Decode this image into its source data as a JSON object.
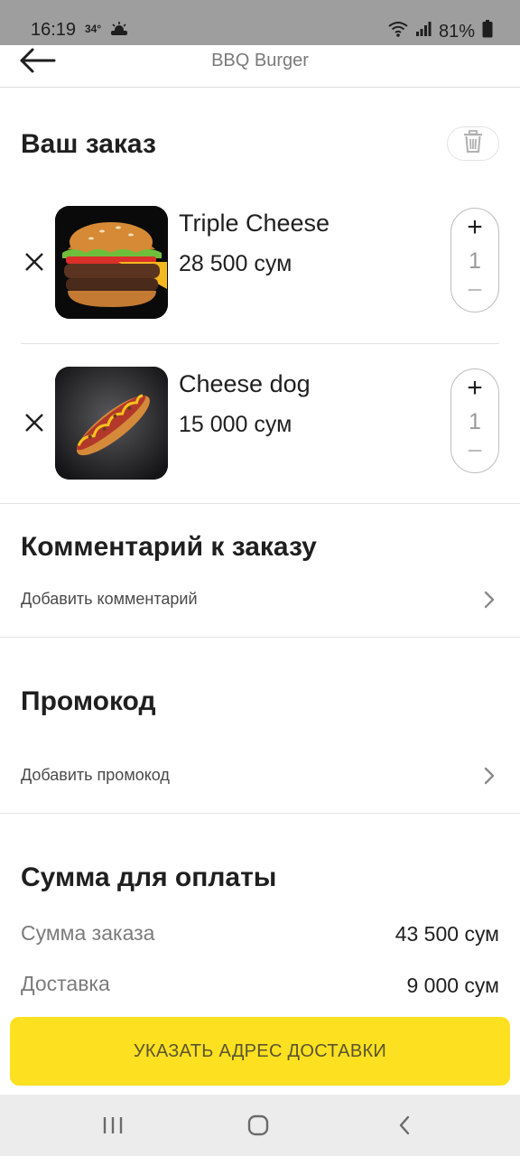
{
  "status": {
    "time": "16:19",
    "temperature": "34°",
    "weather_icon": "sun-cloud-icon",
    "battery": "81%"
  },
  "header": {
    "title": "BBQ Burger"
  },
  "order": {
    "title": "Ваш заказ",
    "items": [
      {
        "name": "Triple Cheese",
        "price": "28 500 сум",
        "qty": "1",
        "plus": "+",
        "minus": "−"
      },
      {
        "name": "Cheese dog",
        "price": "15 000 сум",
        "qty": "1",
        "plus": "+",
        "minus": "−"
      }
    ]
  },
  "comment": {
    "title": "Комментарий к заказу",
    "link": "Добавить комментарий"
  },
  "promo": {
    "title": "Промокод",
    "link": "Добавить промокод"
  },
  "summary": {
    "title": "Сумма для оплаты",
    "order_label": "Сумма заказа",
    "order_value": "43 500 сум",
    "delivery_label": "Доставка",
    "delivery_value": "9 000 сум"
  },
  "cta": {
    "label": "УКАЗАТЬ АДРЕС ДОСТАВКИ",
    "color": "#fde120"
  }
}
